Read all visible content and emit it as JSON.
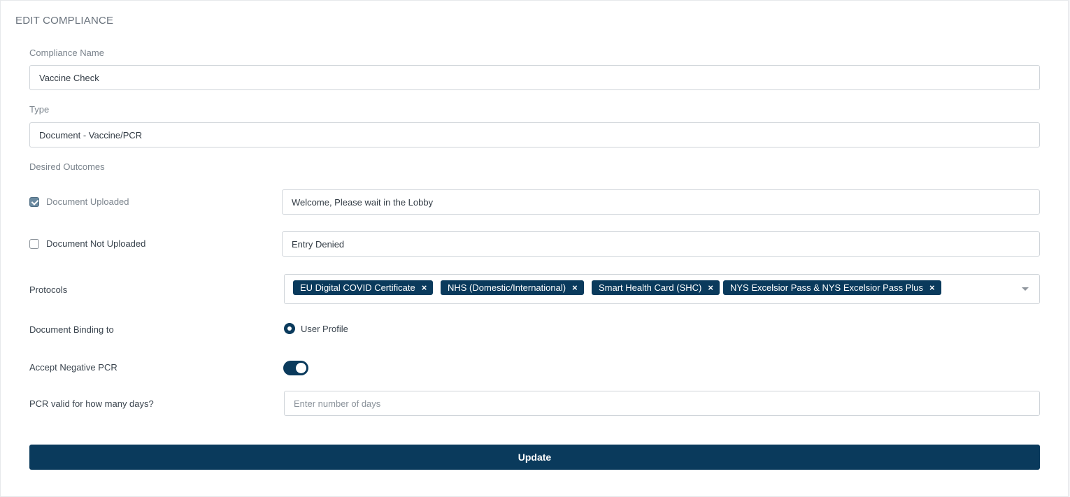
{
  "page": {
    "title": "EDIT COMPLIANCE"
  },
  "form": {
    "compliance_name": {
      "label": "Compliance Name",
      "value": "Vaccine Check"
    },
    "type": {
      "label": "Type",
      "value": "Document - Vaccine/PCR"
    },
    "desired_outcomes": {
      "label": "Desired Outcomes",
      "uploaded": {
        "label": "Document Uploaded",
        "checked": true,
        "message": "Welcome, Please wait in the Lobby"
      },
      "not_uploaded": {
        "label": "Document Not Uploaded",
        "checked": false,
        "message": "Entry Denied"
      }
    },
    "protocols": {
      "label": "Protocols",
      "selected": [
        "EU Digital COVID Certificate",
        "NHS (Domestic/International)",
        "Smart Health Card (SHC)",
        "NYS Excelsior Pass & NYS Excelsior Pass Plus"
      ],
      "remove_glyph": "×"
    },
    "document_binding": {
      "label": "Document Binding to",
      "option": "User Profile",
      "selected": true
    },
    "accept_negative_pcr": {
      "label": "Accept Negative PCR",
      "enabled": true
    },
    "pcr_valid_days": {
      "label": "PCR valid for how many days?",
      "placeholder": "Enter number of days",
      "value": ""
    }
  },
  "actions": {
    "update_label": "Update"
  },
  "colors": {
    "primary": "#0a3a5c",
    "border": "#cfd4d9",
    "muted_text": "#7b848d"
  }
}
